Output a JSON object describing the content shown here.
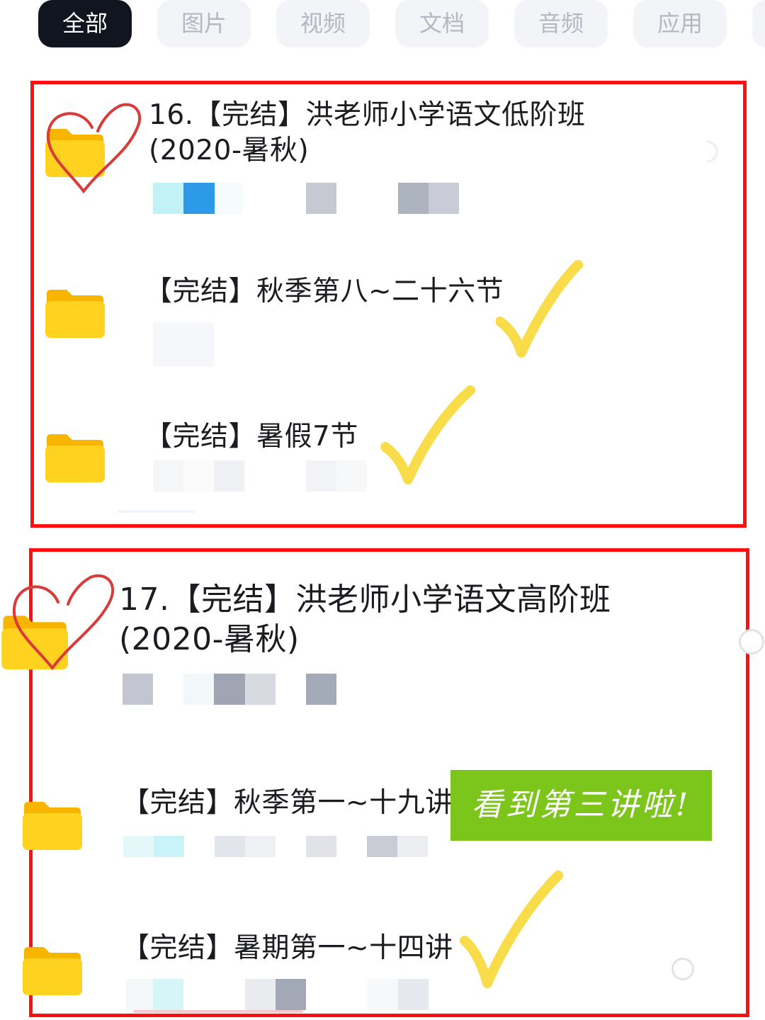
{
  "tabs": [
    {
      "label": "全部",
      "active": true
    },
    {
      "label": "图片",
      "active": false
    },
    {
      "label": "视频",
      "active": false
    },
    {
      "label": "文档",
      "active": false
    },
    {
      "label": "音频",
      "active": false
    },
    {
      "label": "应用",
      "active": false
    }
  ],
  "groups": [
    {
      "title_line1": "16.【完结】洪老师小学语文低阶班",
      "title_line2": "(2020-暑秋)",
      "items": [
        {
          "title": "【完结】秋季第八~二十六节"
        },
        {
          "title": "【完结】暑假7节"
        }
      ]
    },
    {
      "title_line1": "17.【完结】洪老师小学语文高阶班",
      "title_line2": "(2020-暑秋)",
      "items": [
        {
          "title": "【完结】秋季第一~十九讲"
        },
        {
          "title": "【完结】暑期第一~十四讲"
        }
      ]
    }
  ],
  "annotations": {
    "note": "看到第三讲啦!",
    "note_color": "#7cc51a",
    "frame_color": "#ff1010",
    "check_color": "#f7d93a",
    "heart_color": "#d93a3a"
  },
  "colors": {
    "folder": "#ffd21f",
    "tab_active_bg": "#111520",
    "tab_bg": "#f3f4f8"
  }
}
